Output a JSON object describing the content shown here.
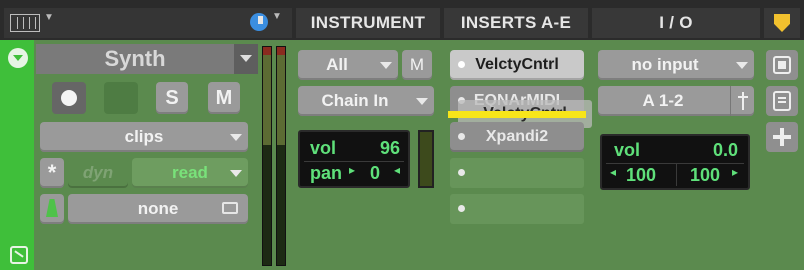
{
  "header": {
    "instrument": "INSTRUMENT",
    "inserts": "INSERTS A-E",
    "io": "I / O"
  },
  "track": {
    "name": "Synth",
    "solo_label": "S",
    "mute_label": "M",
    "playlist": "clips",
    "dyn_label": "dyn",
    "automation_mode": "read",
    "group": "none",
    "star_label": "*"
  },
  "instrument": {
    "filter": "All",
    "midi_m_label": "M",
    "chain": "Chain In",
    "vol_label": "vol",
    "vol_value": "96",
    "pan_label": "pan",
    "pan_value": "0"
  },
  "inserts": {
    "items": [
      "VelctyCntrl",
      "EQNArMIDI",
      "Xpandi2"
    ],
    "drag_ghost": "VelctyCntrl"
  },
  "io": {
    "input": "no input",
    "output": "A 1-2",
    "vol_label": "vol",
    "vol_value": "0.0",
    "pan_left": "100",
    "pan_right": "100"
  },
  "colors": {
    "track_strip": "#3fbf3a",
    "panel_bg": "#5b8a4e",
    "value_text": "#5fe07a",
    "drag_indicator": "#f7e51a",
    "shield": "#f2c12e"
  }
}
